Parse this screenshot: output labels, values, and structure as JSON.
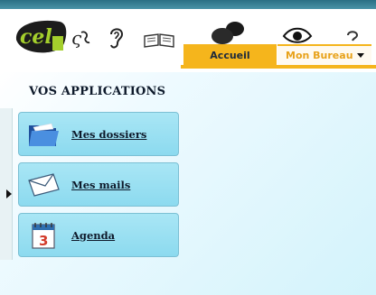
{
  "header": {
    "logo_text": "cel",
    "icons": [
      "dyslexia-icon",
      "hearing-icon",
      "reading-icon",
      "users-icon",
      "eye-icon",
      "help-icon"
    ],
    "tabs": [
      {
        "label": "Accueil",
        "active": false
      },
      {
        "label": "Mon Bureau",
        "active": true,
        "dropdown": true
      }
    ]
  },
  "main": {
    "section_title": "VOS APPLICATIONS",
    "apps": [
      {
        "label": "Mes dossiers",
        "icon": "folder-icon"
      },
      {
        "label": "Mes mails",
        "icon": "mail-icon"
      },
      {
        "label": "Agenda",
        "icon": "calendar-icon",
        "icon_text": "3"
      }
    ]
  },
  "colors": {
    "accent": "#f5b51c",
    "card": "#8cdaef",
    "banner_strip": "#2a6f84",
    "logo_green": "#a4cf2c"
  }
}
